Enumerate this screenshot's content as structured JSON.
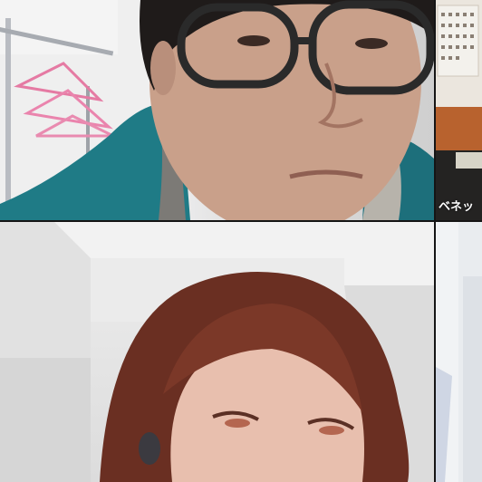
{
  "meeting": {
    "participants": [
      {
        "name_tag": ""
      },
      {
        "name_tag": "ベネッ"
      },
      {
        "name_tag": ""
      },
      {
        "name_tag": ""
      }
    ]
  },
  "colors": {
    "tile_gap": "#151515",
    "name_tag_text": "#ffffff"
  }
}
